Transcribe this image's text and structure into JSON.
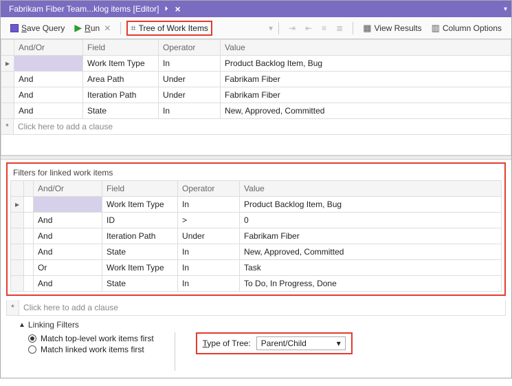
{
  "tab": {
    "title": "Fabrikam Fiber Team...klog items [Editor]"
  },
  "toolbar": {
    "save_label": "Save Query",
    "run_label": "Run",
    "tree_btn": "Tree of Work Items",
    "view_results": "View Results",
    "column_options": "Column Options"
  },
  "columns": {
    "andor": "And/Or",
    "field": "Field",
    "operator": "Operator",
    "value": "Value"
  },
  "top_filters": [
    {
      "andor": "",
      "field": "Work Item Type",
      "op": "In",
      "value": "Product Backlog Item, Bug"
    },
    {
      "andor": "And",
      "field": "Area Path",
      "op": "Under",
      "value": "Fabrikam Fiber"
    },
    {
      "andor": "And",
      "field": "Iteration Path",
      "op": "Under",
      "value": "Fabrikam Fiber"
    },
    {
      "andor": "And",
      "field": "State",
      "op": "In",
      "value": "New, Approved, Committed"
    }
  ],
  "add_clause": "Click here to add a clause",
  "linked": {
    "title": "Filters for linked work items",
    "filters": [
      {
        "andor": "",
        "field": "Work Item Type",
        "op": "In",
        "value": "Product Backlog Item, Bug"
      },
      {
        "andor": "And",
        "field": "ID",
        "op": ">",
        "value": "0"
      },
      {
        "andor": "And",
        "field": "Iteration Path",
        "op": "Under",
        "value": "Fabrikam Fiber"
      },
      {
        "andor": "And",
        "field": "State",
        "op": "In",
        "value": "New, Approved, Committed"
      },
      {
        "andor": "Or",
        "field": "Work Item Type",
        "op": "In",
        "value": "Task"
      },
      {
        "andor": "And",
        "field": "State",
        "op": "In",
        "value": "To Do, In Progress, Done"
      }
    ]
  },
  "linking": {
    "legend": "Linking Filters",
    "opt1": "Match top-level work items first",
    "opt2": "Match linked work items first",
    "type_label": "Type of Tree:",
    "type_value": "Parent/Child"
  }
}
